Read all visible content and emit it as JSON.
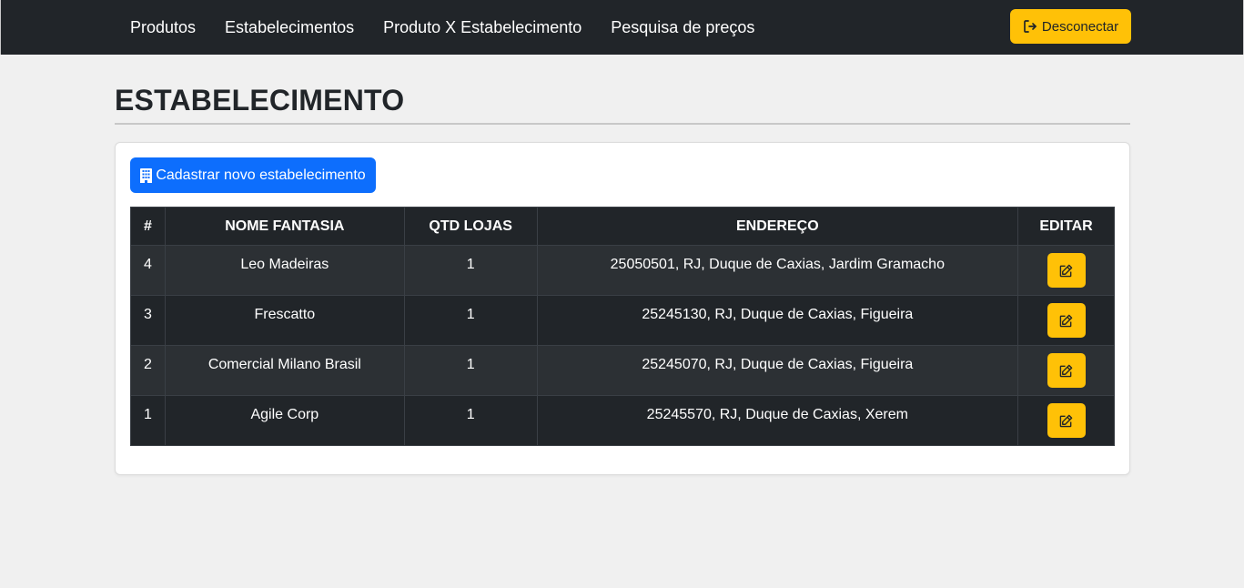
{
  "nav": {
    "items": [
      {
        "label": "Produtos"
      },
      {
        "label": "Estabelecimentos"
      },
      {
        "label": "Produto X Estabelecimento"
      },
      {
        "label": "Pesquisa de preços"
      }
    ],
    "logout_label": "Desconectar",
    "logout_icon": "sign-out-icon"
  },
  "page": {
    "title": "ESTABELECIMENTO"
  },
  "actions": {
    "new_label": "Cadastrar novo estabelecimento",
    "new_icon": "building-icon"
  },
  "table": {
    "headers": [
      "#",
      "NOME FANTASIA",
      "QTD LOJAS",
      "ENDEREÇO",
      "EDITAR"
    ],
    "rows": [
      {
        "id": "4",
        "name": "Leo Madeiras",
        "stores": "1",
        "address": "25050501, RJ, Duque de Caxias, Jardim Gramacho"
      },
      {
        "id": "3",
        "name": "Frescatto",
        "stores": "1",
        "address": "25245130, RJ, Duque de Caxias, Figueira"
      },
      {
        "id": "2",
        "name": "Comercial Milano Brasil",
        "stores": "1",
        "address": "25245070, RJ, Duque de Caxias, Figueira"
      },
      {
        "id": "1",
        "name": "Agile Corp",
        "stores": "1",
        "address": "25245570, RJ, Duque de Caxias, Xerem"
      }
    ],
    "edit_icon": "edit-icon"
  },
  "colors": {
    "navbar_bg": "#212529",
    "primary": "#0d6efd",
    "warning": "#ffc107",
    "table_dark": "#212529",
    "table_stripe": "#2c3034"
  }
}
